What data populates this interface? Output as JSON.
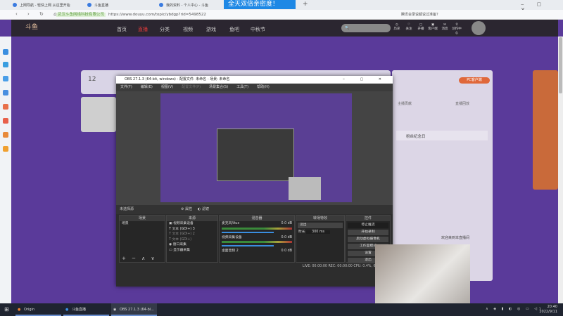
{
  "browser": {
    "tabs": [
      "上网导航 - 轻快上网 从这里开始",
      "斗鱼直播",
      "我的资料 - 个人中心 - 斗鱼"
    ],
    "overlay_text": "全天双倍亲密度！",
    "site_badge": "武汉斗鱼网络科技有限公司",
    "url": "https://www.douyu.com/topic/ybdgp?rid=5498522",
    "search_hint": "腾讯会录说都说过准备？"
  },
  "nav": {
    "items": [
      "首页",
      "直播",
      "分类",
      "视频",
      "游戏",
      "鱼吧",
      "中秋节"
    ],
    "active_color": "#e03a3a",
    "search_placeholder": "",
    "icons": [
      "历史",
      "关注",
      "开播",
      "客户端",
      "消息",
      "创作中心"
    ]
  },
  "room": {
    "level": "12",
    "anchor_initial": "大"
  },
  "right_panel": {
    "client_button": "PC客户端",
    "tabs": [
      "主播贡献",
      "直播回放"
    ],
    "section": "粉丝纪念日",
    "welcome": "欢迎来到本直播间"
  },
  "obs": {
    "title": "OBS 27.1.3 (64-bit, windows) - 配置文件: 未命名 - 场景: 未命名",
    "menu": [
      "文件(F)",
      "编辑(E)",
      "视图(V)",
      "配置文件(P)",
      "场景集合(S)",
      "工具(T)",
      "帮助(H)"
    ],
    "toolbar": {
      "no_source": "未选择源",
      "properties": "属性",
      "filters": "滤镜"
    },
    "scenes": {
      "title": "场景",
      "items": [
        "场景"
      ]
    },
    "sources": {
      "title": "来源",
      "items": [
        "视频采集设备",
        "文本 (GDI+) 3",
        "文本 (GDI+) 2",
        "文本 (GDI+)",
        "窗口采集",
        "显示器采集"
      ]
    },
    "mixer": {
      "title": "混音器",
      "channels": [
        {
          "name": "麦克风/Aux",
          "db": "0.0 dB"
        },
        {
          "name": "视频采集设备",
          "db": "0.0 dB"
        },
        {
          "name": "桌面音频 2",
          "db": "0.0 dB"
        }
      ]
    },
    "transitions": {
      "title": "转场特效",
      "selected": "淡出",
      "duration_label": "时长",
      "duration": "300 ms"
    },
    "controls": {
      "title": "控件",
      "buttons": [
        "停止推流",
        "开始录制",
        "启动虚拟摄像机",
        "工作室模式",
        "设置",
        "退出"
      ]
    },
    "status": "LIVE: 00:00:00   REC: 00:00:00   CPU: 0.4%, 60.00 fps"
  },
  "taskbar": {
    "apps": [
      "Origin",
      "斗鱼直播",
      "OBS 27.1.3 (64-bi..."
    ],
    "time": "20:40",
    "date": "2022/9/11"
  }
}
